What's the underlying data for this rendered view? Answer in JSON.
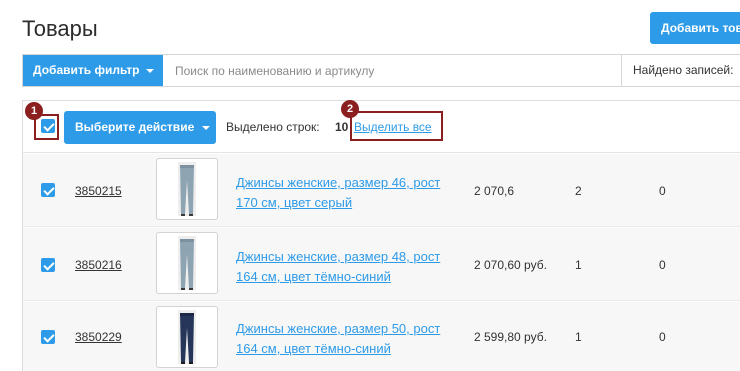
{
  "page": {
    "title": "Товары",
    "add_button_label": "Добавить товар"
  },
  "filter_bar": {
    "add_filter_label": "Добавить фильтр",
    "search_placeholder": "Поиск по наименованию и артикулу",
    "found_records_label": "Найдено записей:"
  },
  "toolbar": {
    "action_label": "Выберите действие",
    "selected_label": "Выделено строк:",
    "selected_count": "10",
    "select_all_label": "Выделить все",
    "master_checkbox_checked": true
  },
  "annotations": [
    {
      "number": "1",
      "target": "master-checkbox"
    },
    {
      "number": "2",
      "target": "select-all-link"
    }
  ],
  "rows": [
    {
      "checked": true,
      "code": "3850215",
      "name": "Джинсы женские, размер 46, рост 170 см, цвет серый",
      "price": "2 070,6",
      "qty": "2",
      "reserve": "0",
      "color": "gray"
    },
    {
      "checked": true,
      "code": "3850216",
      "name": "Джинсы женские, размер 48, рост 164 см, цвет тёмно-синий",
      "price": "2 070,60 руб.",
      "qty": "1",
      "reserve": "0",
      "color": "gray"
    },
    {
      "checked": true,
      "code": "3850229",
      "name": "Джинсы женские, размер 50, рост 164 см, цвет тёмно-синий",
      "price": "2 599,80 руб.",
      "qty": "1",
      "reserve": "0",
      "color": "navy"
    }
  ],
  "colors": {
    "accent": "#2e9be8",
    "marker": "#8b1e1e",
    "jeans_gray": "#8fa4b3",
    "jeans_navy": "#25365a"
  }
}
